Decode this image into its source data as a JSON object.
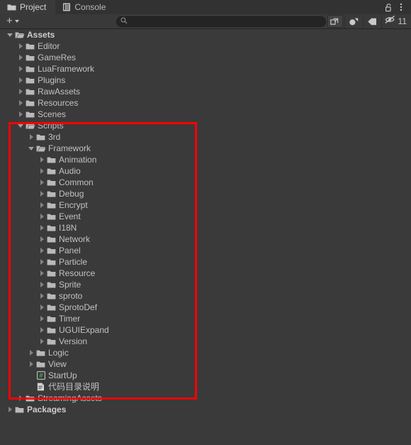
{
  "window": {
    "tabs": [
      {
        "label": "Project",
        "icon": "folder-icon",
        "active": true
      },
      {
        "label": "Console",
        "icon": "console-icon",
        "active": false
      }
    ],
    "header_buttons": [
      {
        "name": "lock-icon",
        "label": "\u0000"
      },
      {
        "name": "kebab-menu-icon",
        "label": "\u0000"
      }
    ]
  },
  "toolbar": {
    "create_label": "+",
    "create_name": "create-dropdown",
    "search": {
      "placeholder": "",
      "value": "",
      "icon": "search-icon"
    },
    "buttons": [
      {
        "name": "open-in-new-window-icon"
      },
      {
        "name": "search-by-type-icon"
      },
      {
        "name": "search-by-label-icon"
      }
    ],
    "hidden_toggle": {
      "icon": "hidden-eye-icon",
      "count": "11"
    }
  },
  "tree": {
    "rows": [
      {
        "label": "Assets",
        "depth": 0,
        "twisty": "down",
        "icon": "folder-open-icon",
        "bold": true
      },
      {
        "label": "Editor",
        "depth": 1,
        "twisty": "right",
        "icon": "folder-icon"
      },
      {
        "label": "GameRes",
        "depth": 1,
        "twisty": "right",
        "icon": "folder-icon"
      },
      {
        "label": "LuaFramework",
        "depth": 1,
        "twisty": "right",
        "icon": "folder-icon"
      },
      {
        "label": "Plugins",
        "depth": 1,
        "twisty": "right",
        "icon": "folder-icon"
      },
      {
        "label": "RawAssets",
        "depth": 1,
        "twisty": "right",
        "icon": "folder-icon"
      },
      {
        "label": "Resources",
        "depth": 1,
        "twisty": "right",
        "icon": "folder-icon"
      },
      {
        "label": "Scenes",
        "depth": 1,
        "twisty": "right",
        "icon": "folder-icon"
      },
      {
        "label": "Scripts",
        "depth": 1,
        "twisty": "down",
        "icon": "folder-open-icon"
      },
      {
        "label": "3rd",
        "depth": 2,
        "twisty": "right",
        "icon": "folder-icon"
      },
      {
        "label": "Framework",
        "depth": 2,
        "twisty": "down",
        "icon": "folder-open-icon"
      },
      {
        "label": "Animation",
        "depth": 3,
        "twisty": "right",
        "icon": "folder-icon"
      },
      {
        "label": "Audio",
        "depth": 3,
        "twisty": "right",
        "icon": "folder-icon"
      },
      {
        "label": "Common",
        "depth": 3,
        "twisty": "right",
        "icon": "folder-icon"
      },
      {
        "label": "Debug",
        "depth": 3,
        "twisty": "right",
        "icon": "folder-icon"
      },
      {
        "label": "Encrypt",
        "depth": 3,
        "twisty": "right",
        "icon": "folder-icon"
      },
      {
        "label": "Event",
        "depth": 3,
        "twisty": "right",
        "icon": "folder-icon"
      },
      {
        "label": "I18N",
        "depth": 3,
        "twisty": "right",
        "icon": "folder-icon"
      },
      {
        "label": "Network",
        "depth": 3,
        "twisty": "right",
        "icon": "folder-icon"
      },
      {
        "label": "Panel",
        "depth": 3,
        "twisty": "right",
        "icon": "folder-icon"
      },
      {
        "label": "Particle",
        "depth": 3,
        "twisty": "right",
        "icon": "folder-icon"
      },
      {
        "label": "Resource",
        "depth": 3,
        "twisty": "right",
        "icon": "folder-icon"
      },
      {
        "label": "Sprite",
        "depth": 3,
        "twisty": "right",
        "icon": "folder-icon"
      },
      {
        "label": "sproto",
        "depth": 3,
        "twisty": "right",
        "icon": "folder-icon"
      },
      {
        "label": "SprotoDef",
        "depth": 3,
        "twisty": "right",
        "icon": "folder-icon"
      },
      {
        "label": "Timer",
        "depth": 3,
        "twisty": "right",
        "icon": "folder-icon"
      },
      {
        "label": "UGUIExpand",
        "depth": 3,
        "twisty": "right",
        "icon": "folder-icon"
      },
      {
        "label": "Version",
        "depth": 3,
        "twisty": "right",
        "icon": "folder-icon"
      },
      {
        "label": "Logic",
        "depth": 2,
        "twisty": "right",
        "icon": "folder-icon"
      },
      {
        "label": "View",
        "depth": 2,
        "twisty": "right",
        "icon": "folder-icon"
      },
      {
        "label": "StartUp",
        "depth": 2,
        "twisty": "none",
        "icon": "csharp-script-icon"
      },
      {
        "label": "代码目录说明",
        "depth": 2,
        "twisty": "none",
        "icon": "text-file-icon"
      },
      {
        "label": "StreamingAssets",
        "depth": 1,
        "twisty": "right",
        "icon": "folder-icon"
      },
      {
        "label": "Packages",
        "depth": 0,
        "twisty": "right",
        "icon": "folder-icon",
        "bold": true
      }
    ]
  },
  "annotation": {
    "name": "red-highlight-box",
    "color": "#fe0000"
  }
}
